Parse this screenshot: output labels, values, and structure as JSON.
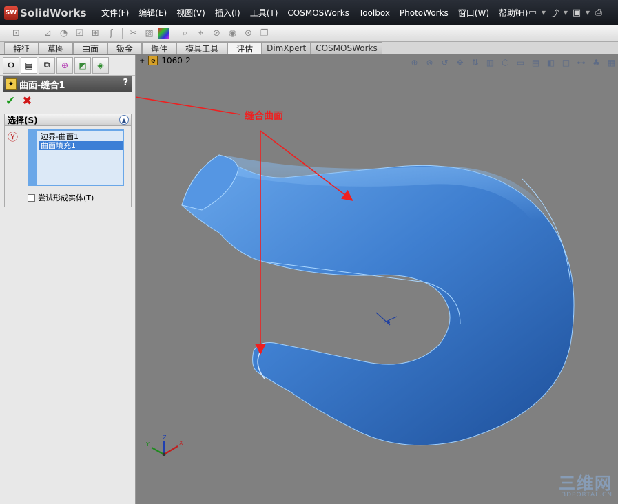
{
  "app": {
    "logo_badge": "SW",
    "logo_name": "SolidWorks",
    "menu": [
      "文件(F)",
      "编辑(E)",
      "视图(V)",
      "插入(I)",
      "工具(T)",
      "COSMOSWorks",
      "Toolbox",
      "PhotoWorks",
      "窗口(W)",
      "帮助(H)"
    ]
  },
  "tabs": [
    "特征",
    "草图",
    "曲面",
    "钣金",
    "焊件",
    "模具工具",
    "评估"
  ],
  "tabs_extra": [
    "DimXpert",
    "COSMOSWorks"
  ],
  "active_tab": "评估",
  "feature": {
    "title": "曲面-缝合1",
    "help": "?",
    "ok": "✔",
    "cancel": "✖"
  },
  "selection": {
    "header": "选择(S)",
    "items": [
      "边界-曲面1",
      "曲面填充1"
    ],
    "selected_index": 1,
    "checkbox_label": "尝试形成实体(T)",
    "checked": false
  },
  "viewport": {
    "part_name": "1060-2",
    "annotation": "缝合曲面",
    "surface_color": "#4f8fdc",
    "annotation_color": "#ee2020"
  },
  "watermark": {
    "big": "三维网",
    "small": "3DPORTAL.CN"
  }
}
